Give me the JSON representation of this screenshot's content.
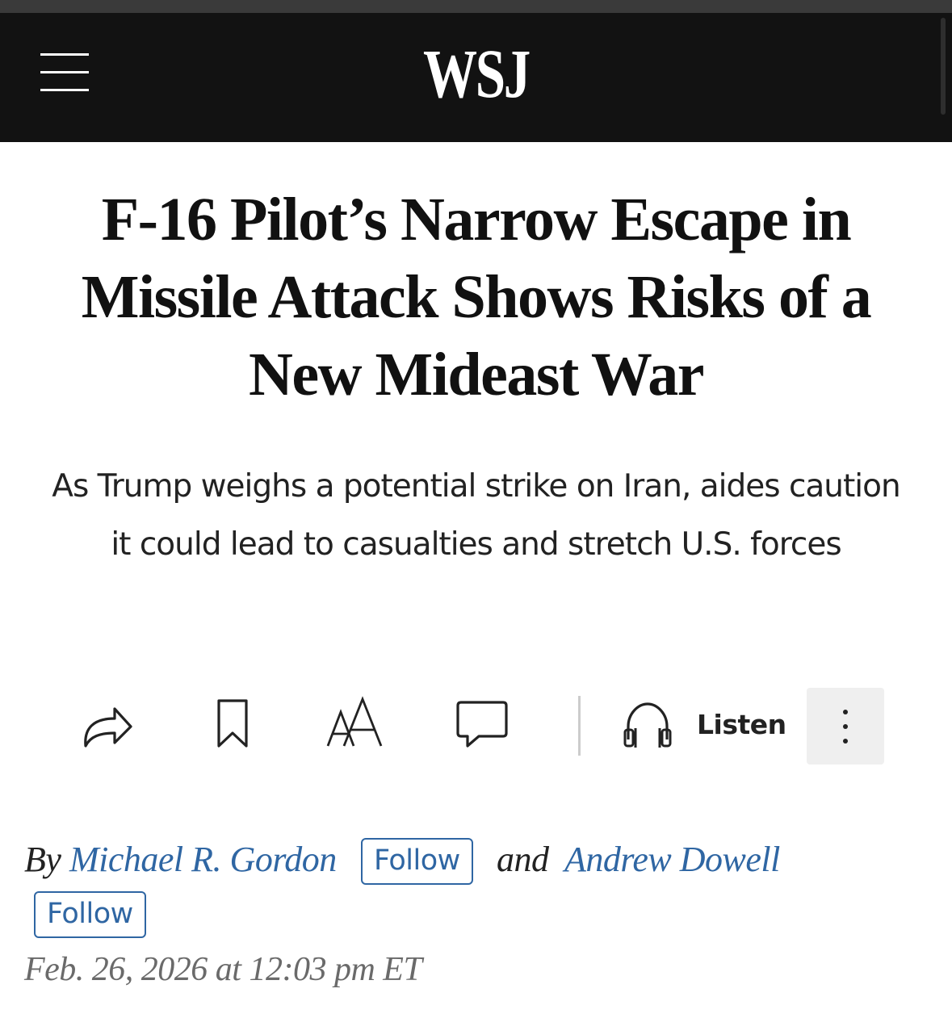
{
  "header": {
    "logo": "WSJ",
    "menu_icon": "hamburger-menu-icon"
  },
  "article": {
    "headline": "F-16 Pilot’s Narrow Escape in Missile Attack Shows Risks of a New Mideast War",
    "dek": "As Trump weighs a potential strike on Iran, aides caution it could lead to casualties and stretch U.S. forces"
  },
  "toolbar": {
    "icons": [
      "share-icon",
      "bookmark-icon",
      "text-size-icon",
      "comment-icon",
      "headphones-icon",
      "more-vertical-icon"
    ],
    "listen_label": "Listen"
  },
  "byline": {
    "by": "By",
    "author1": "Michael R. Gordon",
    "follow1": "Follow",
    "and": "and",
    "author2": "Andrew Dowell",
    "follow2": "Follow"
  },
  "date": "Feb. 26, 2026 at 12:03 pm ET",
  "colors": {
    "header_bg": "#121212",
    "link": "#2f66a3",
    "date": "#6a6a6a"
  }
}
